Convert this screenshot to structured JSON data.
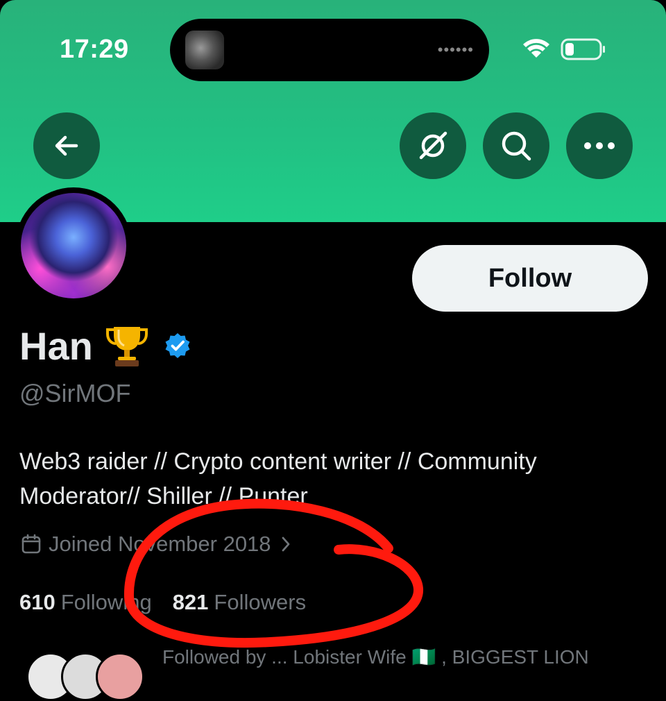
{
  "status_bar": {
    "time": "17:29",
    "island_dots": "••••••"
  },
  "colors": {
    "banner": "#22c083",
    "nav_button": "#105b3f",
    "follow_bg": "#eff3f4",
    "verified": "#1d9bf0",
    "annotation": "#ff1a0e",
    "muted_text": "#71767b"
  },
  "nav": {
    "back_icon": "arrow-left-icon",
    "grok_icon": "grok-icon",
    "search_icon": "search-icon",
    "more_icon": "more-horizontal-icon"
  },
  "profile": {
    "name": "Han",
    "emoji": "trophy",
    "handle": "@SirMOF",
    "bio_line1": "Web3 raider // Crypto content writer // Community",
    "bio_line2": "Moderator// Shiller // Punter",
    "joined": "Joined November 2018",
    "follow_label": "Follow"
  },
  "stats": {
    "following_count": "610",
    "following_label": "Following",
    "followers_count": "821",
    "followers_label": "Followers"
  },
  "followed_by": {
    "text": "Followed by ... Lobister Wife 🇳🇬 , BIGGEST LION"
  }
}
